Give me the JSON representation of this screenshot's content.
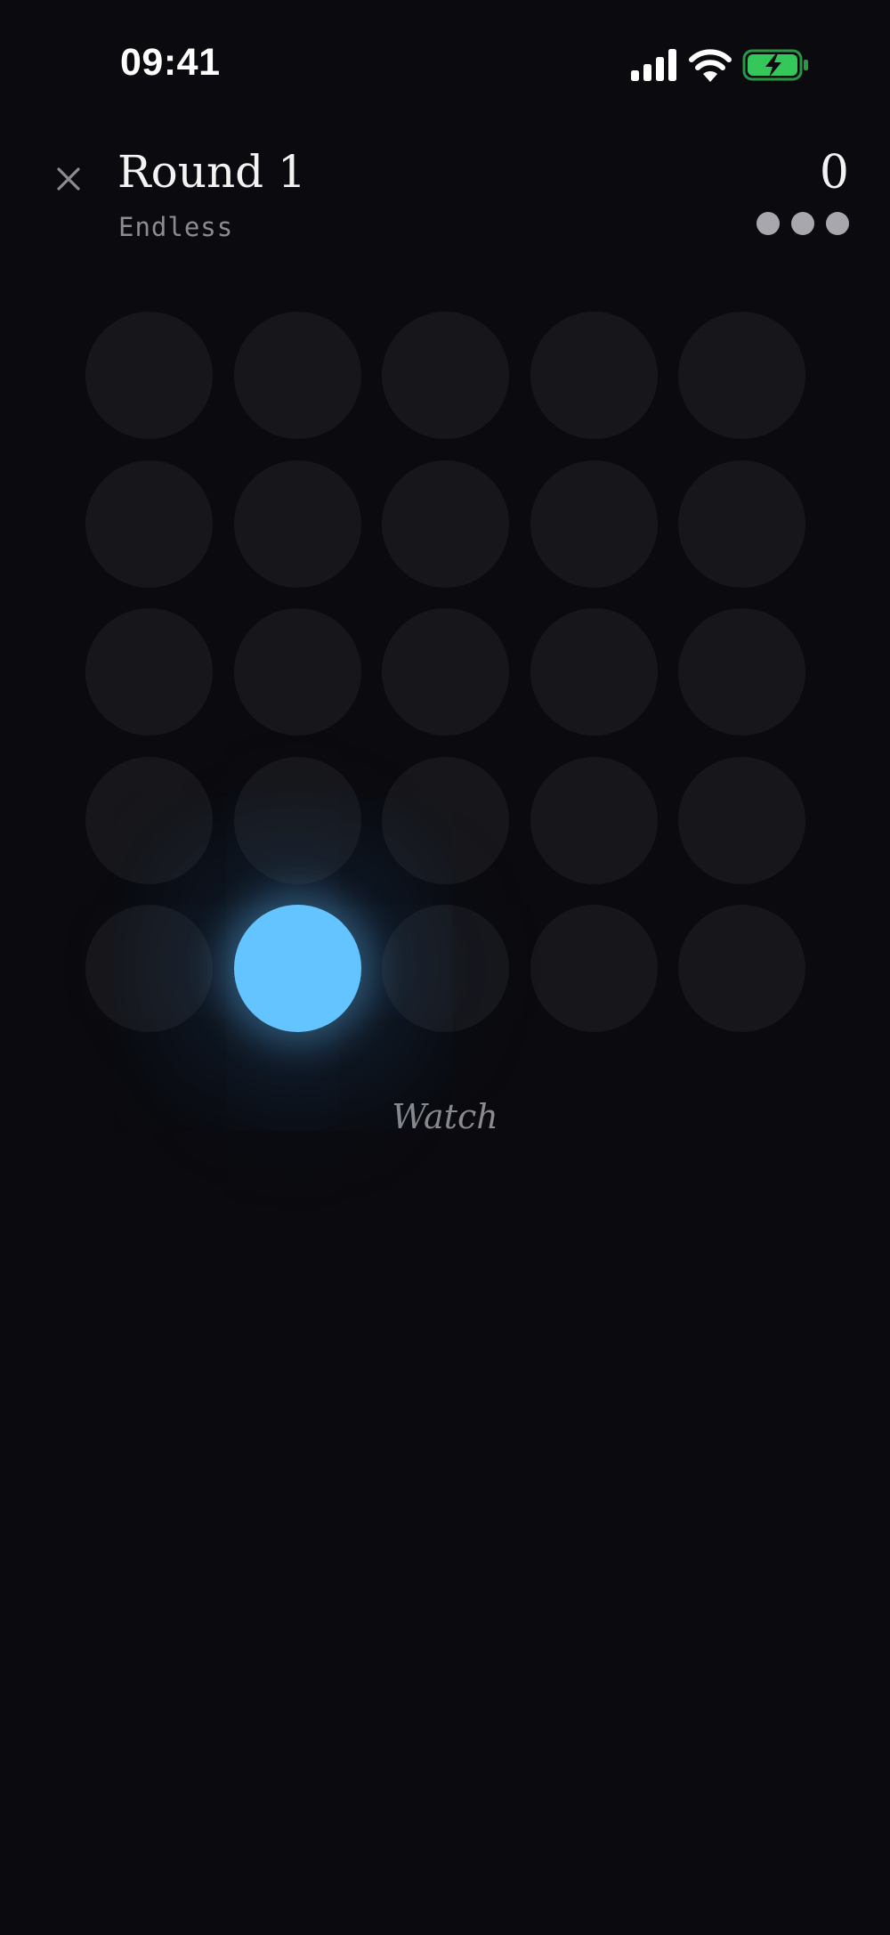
{
  "status_bar": {
    "time": "09:41",
    "icons": [
      "signal-icon",
      "wifi-icon",
      "battery-charging-icon"
    ]
  },
  "header": {
    "close_icon": "close-icon",
    "round_title": "Round 1",
    "mode": "Endless",
    "score": "0",
    "lives_remaining": 3
  },
  "board": {
    "rows": 5,
    "cols": 5,
    "lit_cell": {
      "row": 5,
      "col": 2
    }
  },
  "status_text": "Watch",
  "colors": {
    "background": "#0b0b0f",
    "cell_idle": "#17171b",
    "cell_lit": "#63c4ff",
    "life_dot": "#a7a7ad",
    "battery_fill": "#34c759"
  }
}
